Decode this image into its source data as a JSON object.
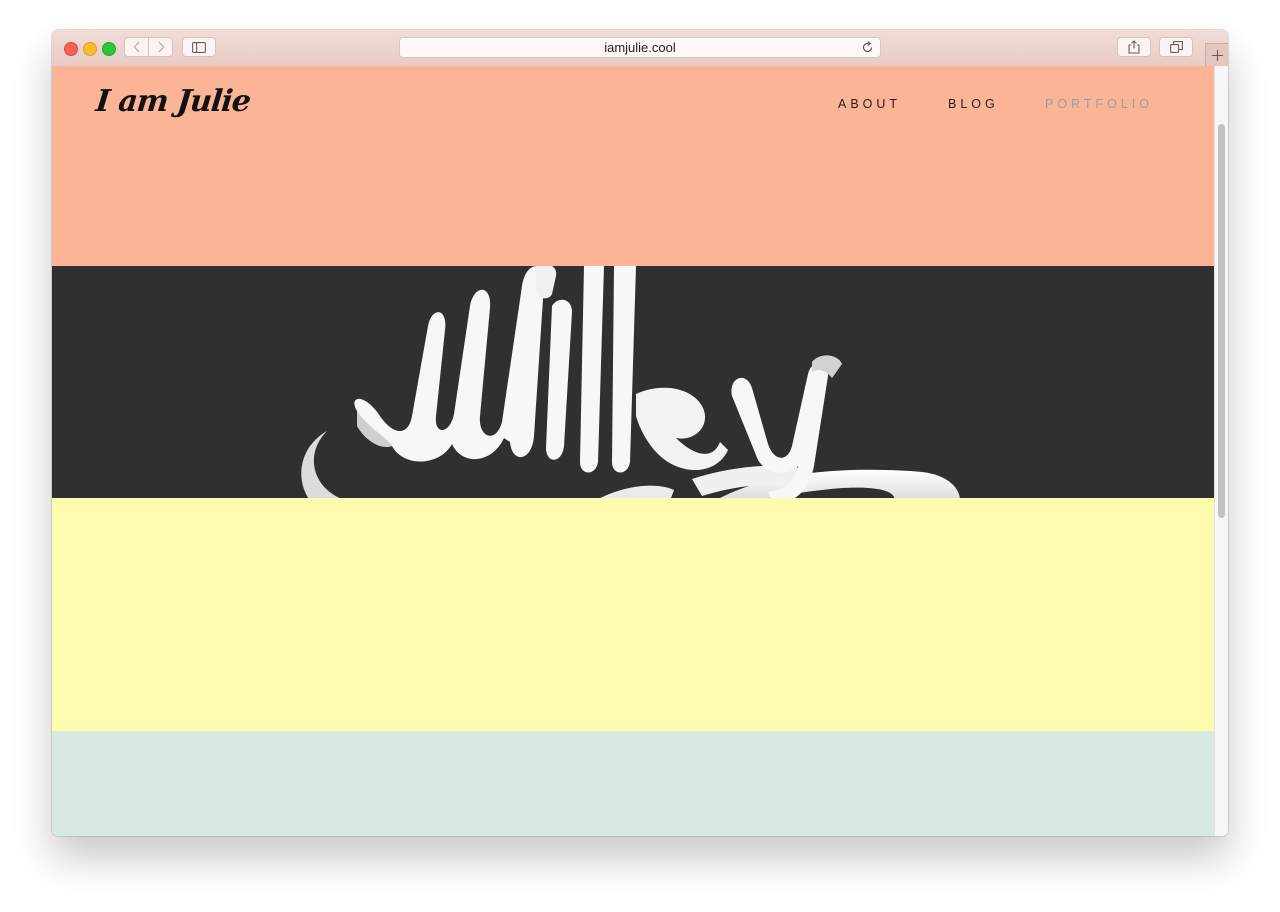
{
  "browser": {
    "url": "iamjulie.cool"
  },
  "site": {
    "logo": "I am Julie",
    "nav": [
      "ABOUT",
      "BLOG",
      "PORTFOLIO"
    ],
    "active_nav": "PORTFOLIO",
    "hero_lettering": "Milky"
  },
  "icons": {
    "back": "chevron-left-icon",
    "forward": "chevron-right-icon",
    "sidebar": "sidebar-icon",
    "reload": "reload-icon",
    "share": "share-icon",
    "tabs": "tabs-overview-icon",
    "new_tab": "plus-icon"
  },
  "colors": {
    "section_peach": "#fbb496",
    "section_dark": "#303030",
    "section_yellow": "#fefbae",
    "section_mint": "#d8e9e2",
    "nav_text": "#222222",
    "nav_active": "#8fa39e",
    "lettering": "#f7f7f7"
  }
}
